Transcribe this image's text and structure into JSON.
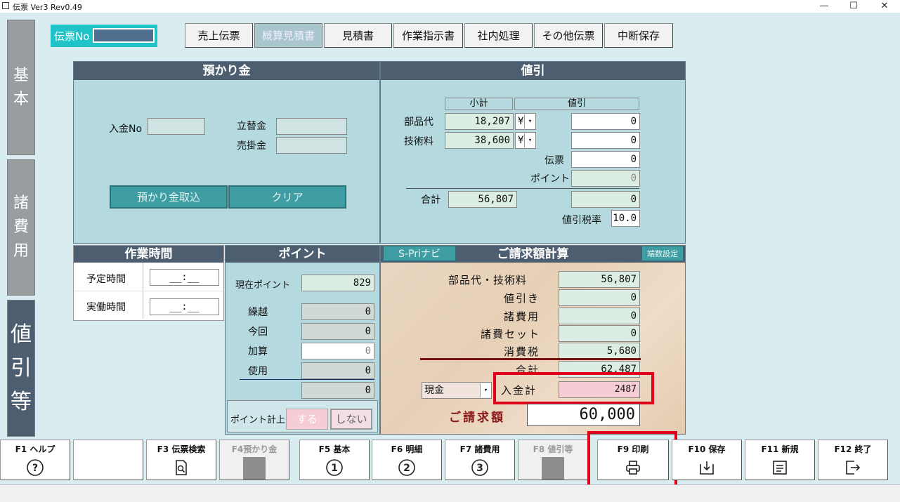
{
  "window": {
    "title": "伝票 Ver3 Rev0.49",
    "minimize": "—",
    "maximize": "☐",
    "close": "✕"
  },
  "left_tabs": [
    {
      "label": "基本"
    },
    {
      "label": "諸費用"
    },
    {
      "label": "値引等"
    }
  ],
  "header": {
    "denno_label": "伝票No",
    "denno_value": ""
  },
  "top_buttons": [
    "売上伝票",
    "概算見積書",
    "見積書",
    "作業指示書",
    "社内処理",
    "その他伝票",
    "中断保存"
  ],
  "azukari": {
    "title": "預かり金",
    "nyukin_no_label": "入金No",
    "nyukin_no": "",
    "tatekae_label": "立替金",
    "tatekae": "",
    "urikake_label": "売掛金",
    "urikake": "",
    "import_btn": "預かり金取込",
    "clear_btn": "クリア"
  },
  "nebiki": {
    "title": "値引",
    "col_subtotal": "小計",
    "col_discount": "値引",
    "buhin_label": "部品代",
    "buhin_subtotal": "18,207",
    "buhin_unit": "¥",
    "buhin_discount": "0",
    "gijutsu_label": "技術料",
    "gijutsu_subtotal": "38,600",
    "gijutsu_unit": "¥",
    "gijutsu_discount": "0",
    "denpyo_label": "伝票",
    "denpyo_discount": "0",
    "point_label": "ポイント",
    "point_discount": "0",
    "total_label": "合計",
    "total_subtotal": "56,807",
    "total_discount": "0",
    "taxrate_label": "値引税率",
    "taxrate": "10.0"
  },
  "sagyo": {
    "title": "作業時間",
    "yotei_label": "予定時間",
    "yotei_value": "__:__",
    "jitsudo_label": "実働時間",
    "jitsudo_value": "__:__"
  },
  "point": {
    "title": "ポイント",
    "current_label": "現在ポイント",
    "current": "829",
    "kurikoshi_label": "繰越",
    "kurikoshi": "0",
    "konkai_label": "今回",
    "konkai": "0",
    "kasan_label": "加算",
    "kasan": "0",
    "shiyo_label": "使用",
    "shiyo": "0",
    "result": "0",
    "keijo_label": "ポイント計上",
    "suru": "する",
    "shinai": "しない"
  },
  "seikyu": {
    "title": "ご請求額計算",
    "navi_btn": "S-Priナビ",
    "hasu_btn": "端数設定",
    "buhin_gijutsu_label": "部品代・技術料",
    "buhin_gijutsu": "56,807",
    "nebiki_label": "値引き",
    "nebiki": "0",
    "shohiyo_label": "諸費用",
    "shohiyo": "0",
    "shohi_set_label": "諸費セット",
    "shohi_set": "0",
    "shohizei_label": "消費税",
    "shohizei": "5,680",
    "gokei_label": "合計",
    "gokei": "62,487",
    "payment_method": "現金",
    "nyukin_label": "入金計",
    "nyukin": "2487",
    "seikyu_label": "ご請求額",
    "seikyu": "60,000"
  },
  "fkeys": [
    {
      "label": "F1 ヘルプ",
      "icon": "help-circle-icon"
    },
    {
      "label": "",
      "icon": ""
    },
    {
      "label": "F3 伝票検索",
      "icon": "document-search-icon"
    },
    {
      "label": "F4預かり金",
      "icon": "grey-square-icon"
    },
    {
      "label": "F5 基本",
      "icon": "circled-one-icon"
    },
    {
      "label": "F6 明細",
      "icon": "circled-two-icon"
    },
    {
      "label": "F7 諸費用",
      "icon": "circled-three-icon"
    },
    {
      "label": "F8 値引等",
      "icon": "grey-square-icon"
    },
    {
      "label": "F9 印刷",
      "icon": "printer-icon"
    },
    {
      "label": "F10 保存",
      "icon": "download-tray-icon"
    },
    {
      "label": "F11 新規",
      "icon": "new-document-icon"
    },
    {
      "label": "F12 終了",
      "icon": "exit-icon"
    }
  ],
  "colors": {
    "header_bg": "#4e5e71",
    "panel_bg": "#b4d9df",
    "teal": "#3f9ea3",
    "highlight_red": "#e0001a",
    "nyukin_bg": "#f6cdd5"
  }
}
